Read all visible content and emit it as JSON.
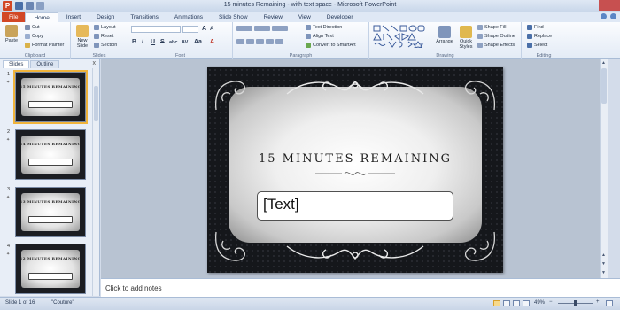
{
  "window": {
    "title": "15 minutes Remaining - with text space - Microsoft PowerPoint",
    "app_icon_label": "P"
  },
  "ribbon_tabs": [
    "File",
    "Home",
    "Insert",
    "Design",
    "Transitions",
    "Animations",
    "Slide Show",
    "Review",
    "View",
    "Developer"
  ],
  "ribbon": {
    "clipboard": {
      "paste": "Paste",
      "cut": "Cut",
      "copy": "Copy",
      "format_painter": "Format Painter",
      "label": "Clipboard"
    },
    "slides": {
      "new_slide": "New Slide",
      "layout": "Layout",
      "reset": "Reset",
      "section": "Section",
      "label": "Slides"
    },
    "font": {
      "label": "Font",
      "bold": "B",
      "italic": "I",
      "underline": "U",
      "strike": "S",
      "shadow": "abc",
      "spacing": "AV",
      "case": "Aa",
      "color": "A",
      "grow": "A",
      "shrink": "A"
    },
    "paragraph": {
      "text_direction": "Text Direction",
      "align_text": "Align Text",
      "convert_smartart": "Convert to SmartArt",
      "label": "Paragraph"
    },
    "drawing": {
      "arrange": "Arrange",
      "quick_styles": "Quick Styles",
      "shape_fill": "Shape Fill",
      "shape_outline": "Shape Outline",
      "shape_effects": "Shape Effects",
      "label": "Drawing"
    },
    "editing": {
      "find": "Find",
      "replace": "Replace",
      "select": "Select",
      "label": "Editing"
    }
  },
  "left_pane": {
    "tabs": [
      "Slides",
      "Outline"
    ],
    "close": "x",
    "thumbnails": [
      {
        "number": "1",
        "title": "15 MINUTES REMAINING"
      },
      {
        "number": "2",
        "title": "14 MINUTES REMAINING"
      },
      {
        "number": "3",
        "title": "13 MINUTES REMAINING"
      },
      {
        "number": "4",
        "title": "12 MINUTES REMAINING"
      }
    ]
  },
  "slide": {
    "title": "15 MINUTES REMAINING",
    "textbox": "[Text]"
  },
  "notes": {
    "placeholder": "Click to add notes"
  },
  "status_bar": {
    "slide_info": "Slide 1 of 16",
    "theme": "\"Couture\"",
    "zoom": "49%"
  },
  "colors": {
    "file_tab": "#d24726",
    "selected_thumb_border": "#f0b43c",
    "slide_background": "#15171b"
  }
}
